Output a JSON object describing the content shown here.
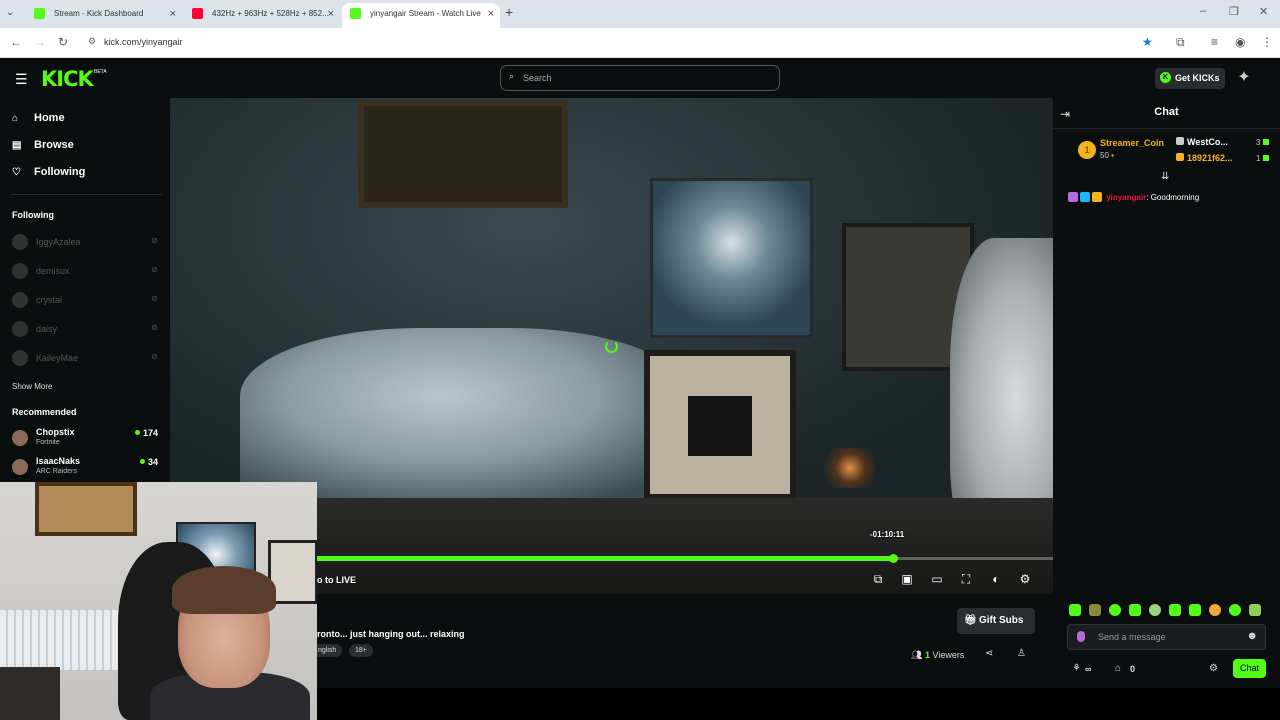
{
  "browser": {
    "tabs": [
      {
        "title": "Stream - Kick Dashboard",
        "favicon_color": "#53fc18"
      },
      {
        "title": "432Hz + 963Hz + 528Hz + 852...",
        "favicon_color": "#ff0033"
      },
      {
        "title": "yinyangair Stream - Watch Live",
        "favicon_color": "#53fc18"
      }
    ],
    "url": "kick.com/yinyangair"
  },
  "header": {
    "logo": "KICK",
    "logo_badge": "BETA",
    "search_placeholder": "Search",
    "get_kicks_label": "Get KICKs"
  },
  "sidebar": {
    "nav": [
      {
        "label": "Home",
        "icon": "home-icon"
      },
      {
        "label": "Browse",
        "icon": "browse-icon"
      },
      {
        "label": "Following",
        "icon": "heart-icon"
      }
    ],
    "following_title": "Following",
    "following": [
      {
        "name": "IggyAzalea"
      },
      {
        "name": "demisux"
      },
      {
        "name": "crystal"
      },
      {
        "name": "daisy"
      },
      {
        "name": "KaileyMae"
      }
    ],
    "show_more": "Show More",
    "recommended_title": "Recommended",
    "recommended": [
      {
        "name": "Chopstix",
        "category": "Fortnite",
        "viewers": "174"
      },
      {
        "name": "IsaacNaks",
        "category": "ARC Raiders",
        "viewers": "34"
      }
    ]
  },
  "player": {
    "time_tooltip": "-01:10:11",
    "progress_fraction": 0.782,
    "go_live_label": "o to LIVE"
  },
  "stream_info": {
    "title": "ronto... just hanging out... relaxing",
    "tags": [
      "nglish",
      "18+"
    ],
    "gift_subs_label": "Gift Subs",
    "viewers_count": "1",
    "viewers_label": "Viewers"
  },
  "chat": {
    "title": "Chat",
    "leaderboard": {
      "rank": "1",
      "name": "Streamer_Coin",
      "amount": "50"
    },
    "gifters": [
      {
        "name": "WestCo...",
        "count": "3",
        "color": "#ffffff"
      },
      {
        "name": "18921f62...",
        "count": "1",
        "color": "#f5b31b"
      }
    ],
    "messages": [
      {
        "user": "yinyangair",
        "text": ": Goodmorning"
      }
    ],
    "input_placeholder": "Send a message",
    "footer_count_1": "∞",
    "footer_count_2": "0",
    "send_label": "Chat"
  },
  "colors": {
    "accent": "#53fc18",
    "background": "#0b0e0f"
  }
}
